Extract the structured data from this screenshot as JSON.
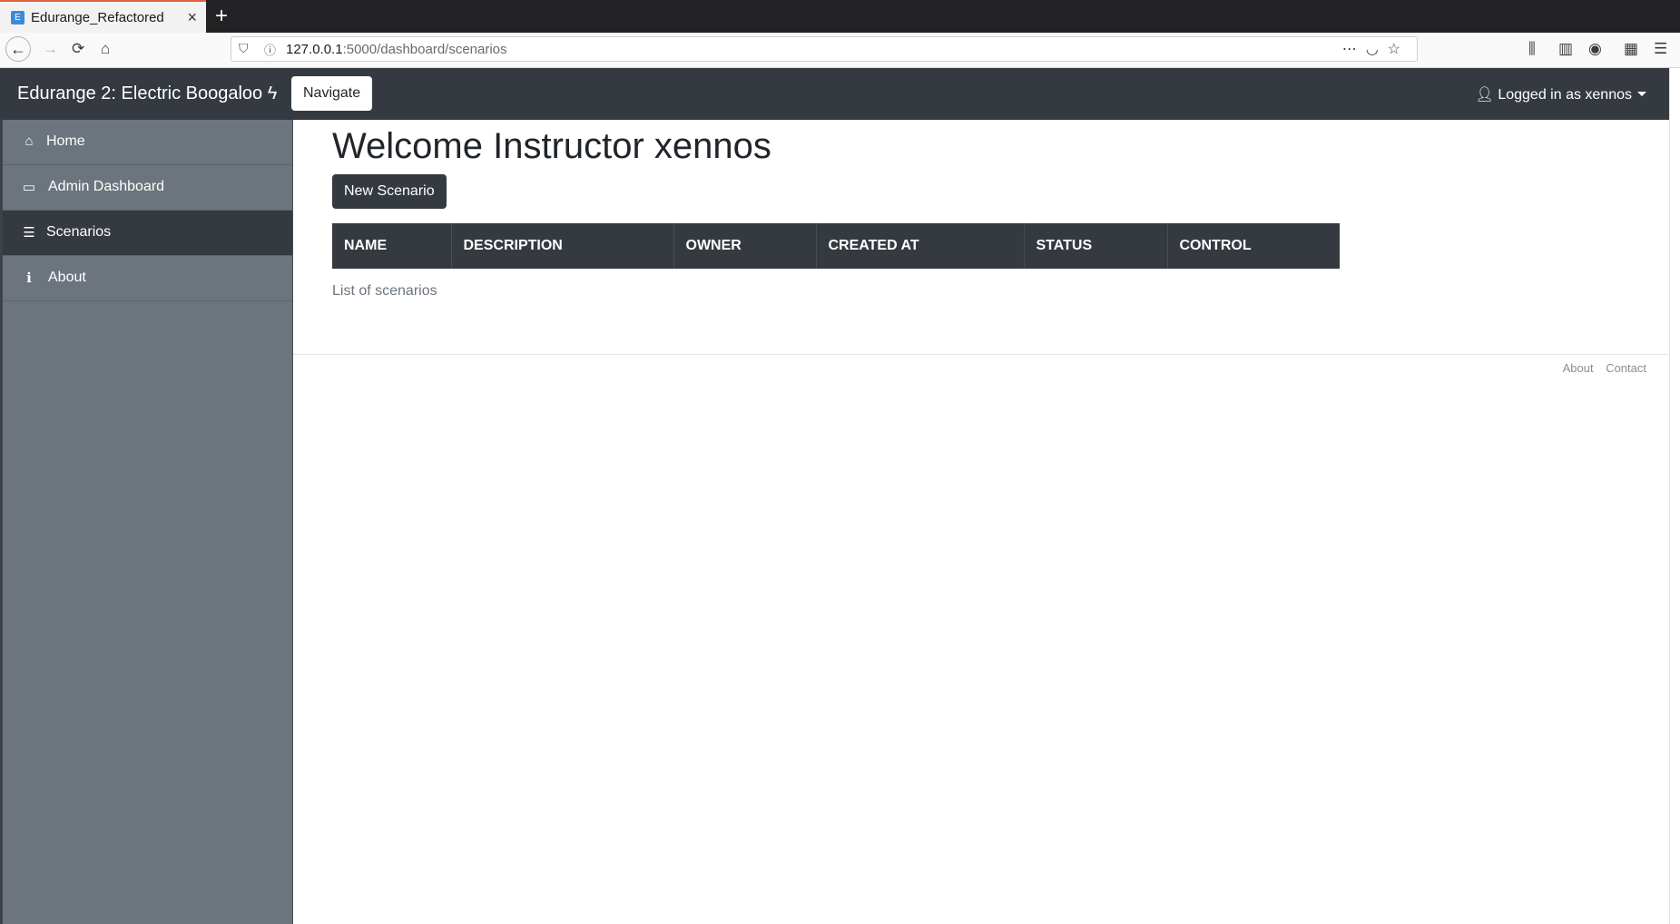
{
  "browser": {
    "tab_title": "Edurange_Refactored",
    "tab_favicon": "E",
    "url_host": "127.0.0.1",
    "url_rest": ":5000/dashboard/scenarios"
  },
  "navbar": {
    "brand": "Edurange 2: Electric Boogaloo",
    "navigate_label": "Navigate",
    "user_label": "Logged in as xennos"
  },
  "sidebar": {
    "items": [
      {
        "label": "Home",
        "icon": "home-icon"
      },
      {
        "label": "Admin Dashboard",
        "icon": "monitor-icon"
      },
      {
        "label": "Scenarios",
        "icon": "list-icon",
        "active": true
      },
      {
        "label": "About",
        "icon": "info-icon"
      }
    ]
  },
  "main": {
    "title": "Welcome Instructor xennos",
    "new_scenario_label": "New Scenario",
    "table": {
      "columns": [
        "NAME",
        "DESCRIPTION",
        "OWNER",
        "CREATED AT",
        "STATUS",
        "CONTROL"
      ],
      "caption": "List of scenarios"
    }
  },
  "footer": {
    "links": [
      "About",
      "Contact"
    ]
  }
}
